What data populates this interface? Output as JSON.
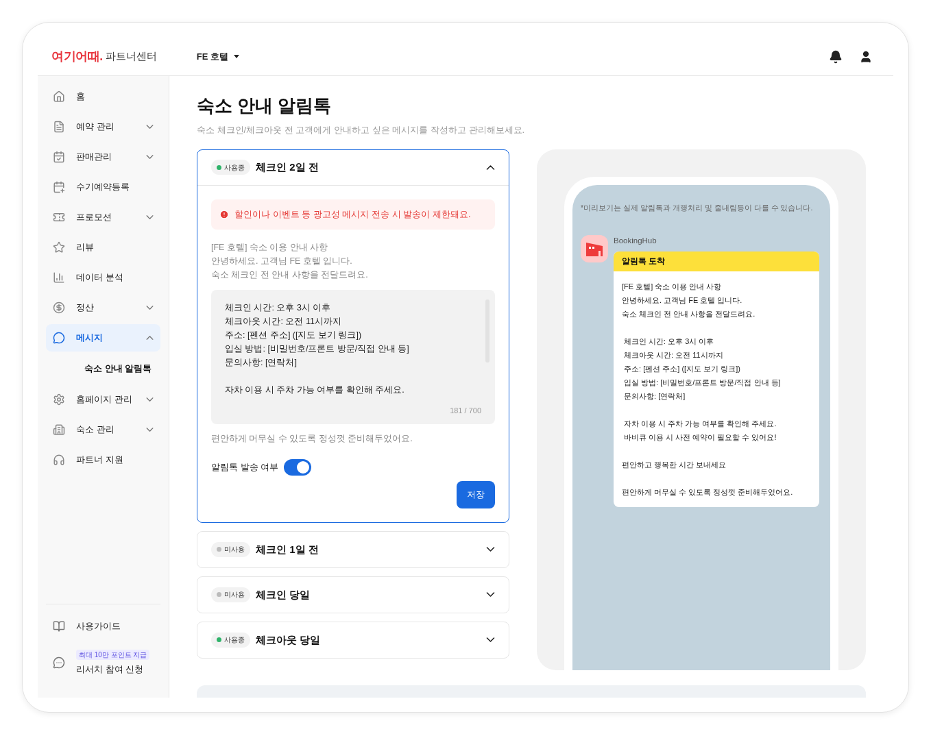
{
  "header": {
    "logo": "여기어때.",
    "logo_suffix": "파트너센터",
    "property": "FE 호텔"
  },
  "sidebar": {
    "items": [
      {
        "label": "홈",
        "selected": false
      },
      {
        "label": "예약 관리",
        "selected": false,
        "expanded": false
      },
      {
        "label": "판매관리",
        "selected": false,
        "expanded": false
      },
      {
        "label": "수기예약등록",
        "selected": false
      },
      {
        "label": "프로모션",
        "selected": false,
        "expanded": false
      },
      {
        "label": "리뷰",
        "selected": false
      },
      {
        "label": "데이터 분석",
        "selected": false
      },
      {
        "label": "정산",
        "selected": false,
        "expanded": false
      },
      {
        "label": "메시지",
        "selected": true,
        "expanded": true,
        "children": [
          {
            "label": "숙소 안내 알림톡",
            "selected": true
          }
        ]
      },
      {
        "label": "홈페이지 관리",
        "selected": false,
        "expanded": false
      },
      {
        "label": "숙소 관리",
        "selected": false,
        "expanded": false
      },
      {
        "label": "파트너 지원",
        "selected": false
      }
    ],
    "footer": [
      {
        "label": "사용가이드"
      },
      {
        "label": "리서치 참여 신청",
        "badge": "최대 10만 포인트 지급"
      }
    ]
  },
  "page": {
    "title": "숙소 안내 알림톡",
    "subtitle": "숙소 체크인/체크아웃 전 고객에게 안내하고 싶은 메시지를 작성하고 관리해보세요."
  },
  "templates": [
    {
      "status": "사용중",
      "active": true,
      "title": "체크인 2일 전",
      "expanded": true,
      "warning": "할인이나 이벤트 등 광고성 메시지 전송 시 발송이 제한돼요.",
      "intro": [
        "[FE 호텔] 숙소 이용 안내 사항",
        "안녕하세요. 고객님 FE 호텔 입니다.",
        "숙소 체크인 전 안내 사항을 전달드려요."
      ],
      "body": [
        [
          "체크인 시간: 오후 3시 이후",
          "체크아웃 시간: 오전 11시까지",
          "주소: [펜션 주소] ([지도 보기 링크])",
          "입실 방법: [비밀번호/프론트 방문/직접 안내 등]",
          "문의사항: [연락처]"
        ],
        [
          "자차 이용 시 주차 가능 여부를 확인해 주세요."
        ]
      ],
      "counter": "181 / 700",
      "closing": "편안하게 머무실 수 있도록 정성껏 준비해두었어요.",
      "toggle_label": "알림톡 발송 여부",
      "toggle_on": true,
      "save": "저장"
    },
    {
      "status": "미사용",
      "active": false,
      "title": "체크인 1일 전",
      "expanded": false
    },
    {
      "status": "미사용",
      "active": false,
      "title": "체크인 당일",
      "expanded": false
    },
    {
      "status": "사용중",
      "active": true,
      "title": "체크아웃 당일",
      "expanded": false
    }
  ],
  "preview": {
    "notice": "*미리보기는 실제 알림톡과 개행처리 및 줄내림등이 다를 수 있습니다.",
    "sender": "BookingHub",
    "bubble_title": "알림톡 도착",
    "blocks": [
      [
        "[FE 호텔] 숙소 이용 안내 사항",
        "안녕하세요. 고객님 FE 호텔 입니다.",
        "숙소 체크인 전 안내 사항을 전달드려요."
      ],
      [
        " 체크인 시간: 오후 3시 이후",
        " 체크아웃 시간: 오전 11시까지",
        " 주소: [펜션 주소] ([지도 보기 링크])",
        " 입실 방법: [비밀번호/프론트 방문/직접 안내 등]",
        " 문의사항: [연락처]"
      ],
      [
        " 자차 이용 시 주차 가능 여부를 확인해 주세요.",
        " 바비큐 이용 시 사전 예약이 필요할 수 있어요!"
      ],
      [
        "편안하고 행복한 시간 보내세요"
      ],
      [
        "편안하게 머무실 수 있도록 정성껏 준비해두었어요."
      ]
    ]
  }
}
